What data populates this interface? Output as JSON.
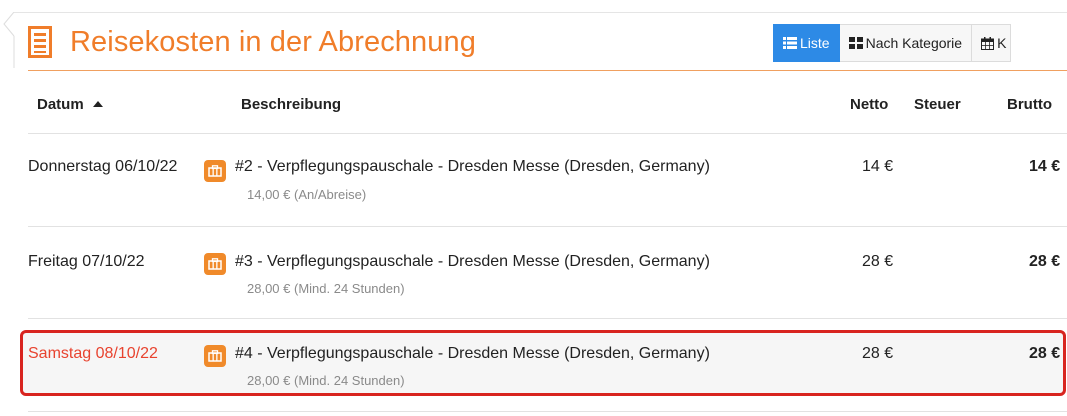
{
  "header": {
    "title": "Reisekosten in der Abrechnung"
  },
  "view_tabs": [
    {
      "label": "Liste",
      "icon": "list-icon",
      "active": true
    },
    {
      "label": "Nach Kategorie",
      "icon": "grid-icon",
      "active": false
    },
    {
      "label": "K",
      "icon": "calendar-icon",
      "active": false
    }
  ],
  "table": {
    "columns": {
      "datum": "Datum",
      "beschreibung": "Beschreibung",
      "netto": "Netto",
      "steuer": "Steuer",
      "brutto": "Brutto"
    },
    "rows": [
      {
        "date": "Donnerstag 06/10/22",
        "description": "#2 - Verpflegungspauschale - Dresden Messe (Dresden, Germany)",
        "sub": "14,00 € (An/Abreise)",
        "netto": "14 €",
        "steuer": "",
        "brutto": "14 €",
        "highlighted": false
      },
      {
        "date": "Freitag 07/10/22",
        "description": "#3 - Verpflegungspauschale - Dresden Messe (Dresden, Germany)",
        "sub": "28,00 € (Mind. 24 Stunden)",
        "netto": "28 €",
        "steuer": "",
        "brutto": "28 €",
        "highlighted": false
      },
      {
        "date": "Samstag 08/10/22",
        "description": "#4 - Verpflegungspauschale - Dresden Messe (Dresden, Germany)",
        "sub": "28,00 € (Mind. 24 Stunden)",
        "netto": "28 €",
        "steuer": "",
        "brutto": "28 €",
        "highlighted": true
      }
    ]
  },
  "colors": {
    "accent": "#f07d2a",
    "active_tab": "#2d8ae6",
    "highlight": "#d8241f",
    "highlight_date": "#e8432f"
  }
}
